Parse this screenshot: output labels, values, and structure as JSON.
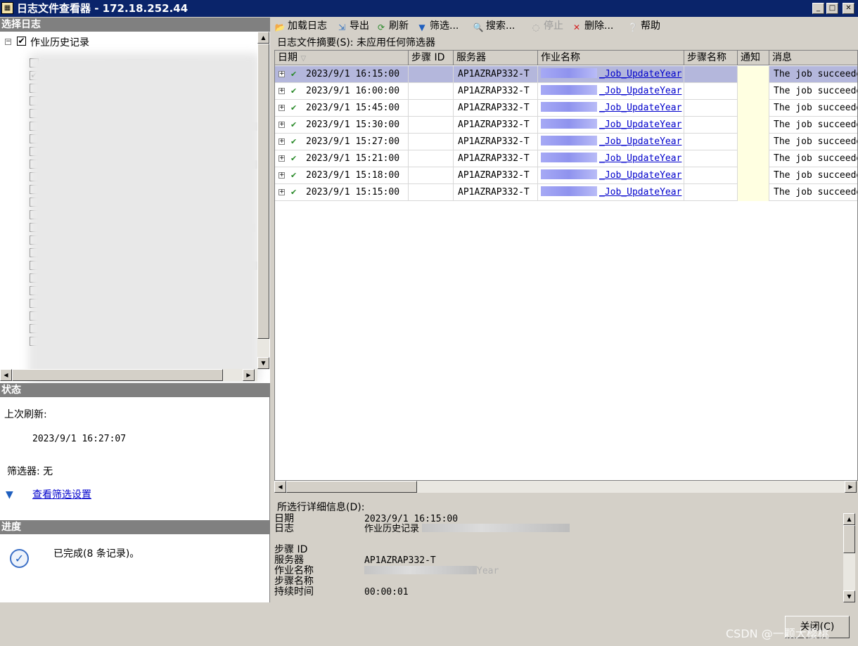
{
  "window": {
    "title": "日志文件查看器 - 172.18.252.44",
    "icon_glyph": "▦"
  },
  "left_panel": {
    "select_log_header": "选择日志",
    "tree_root_label": "作业历史记录",
    "status_header": "状态",
    "last_refresh_label": "上次刷新:",
    "last_refresh_value": "2023/9/1 16:27:07",
    "filter_label": "筛选器: 无",
    "view_filter_link": "查看筛选设置",
    "progress_header": "进度",
    "progress_text": "已完成(8 条记录)。"
  },
  "toolbar": {
    "load_log": "加载日志",
    "export": "导出",
    "refresh": "刷新",
    "filter": "筛选...",
    "search": "搜索...",
    "stop": "停止",
    "delete": "删除...",
    "help": "帮助"
  },
  "summary": "日志文件摘要(S): 未应用任何筛选器",
  "grid": {
    "columns": {
      "date": "日期",
      "step_id": "步骤 ID",
      "server": "服务器",
      "job_name": "作业名称",
      "step_name": "步骤名称",
      "notify": "通知",
      "message": "消息"
    },
    "rows": [
      {
        "date": "2023/9/1 16:15:00",
        "server": "AP1AZRAP332-T",
        "job": "_Job_UpdateYear",
        "message": "The job succeeded"
      },
      {
        "date": "2023/9/1 16:00:00",
        "server": "AP1AZRAP332-T",
        "job": "_Job_UpdateYear",
        "message": "The job succeeded"
      },
      {
        "date": "2023/9/1 15:45:00",
        "server": "AP1AZRAP332-T",
        "job": "_Job_UpdateYear",
        "message": "The job succeeded"
      },
      {
        "date": "2023/9/1 15:30:00",
        "server": "AP1AZRAP332-T",
        "job": "_Job_UpdateYear",
        "message": "The job succeeded"
      },
      {
        "date": "2023/9/1 15:27:00",
        "server": "AP1AZRAP332-T",
        "job": "_Job_UpdateYear",
        "message": "The job succeeded"
      },
      {
        "date": "2023/9/1 15:21:00",
        "server": "AP1AZRAP332-T",
        "job": "_Job_UpdateYear",
        "message": "The job succeeded"
      },
      {
        "date": "2023/9/1 15:18:00",
        "server": "AP1AZRAP332-T",
        "job": "_Job_UpdateYear",
        "message": "The job succeeded"
      },
      {
        "date": "2023/9/1 15:15:00",
        "server": "AP1AZRAP332-T",
        "job": "_Job_UpdateYear",
        "message": "The job succeeded"
      }
    ]
  },
  "details": {
    "header": "所选行详细信息(D):",
    "date_label": "日期",
    "date_value": "2023/9/1 16:15:00",
    "log_label": "日志",
    "log_value": "作业历史记录",
    "step_id_label": "步骤 ID",
    "server_label": "服务器",
    "server_value": "AP1AZRAP332-T",
    "job_name_label": "作业名称",
    "job_name_tail": "Year",
    "step_name_label": "步骤名称",
    "duration_label": "持续时间",
    "duration_value": "00:00:01"
  },
  "close_button": "关闭(C)",
  "watermark": "CSDN @一颗大樱桃",
  "colors": {
    "titlebar": "#0a246a",
    "selected_row": "#b4b7dc",
    "notify_cell": "#ffffe1",
    "link": "#0000cc",
    "success_check": "#2a8a2a"
  }
}
